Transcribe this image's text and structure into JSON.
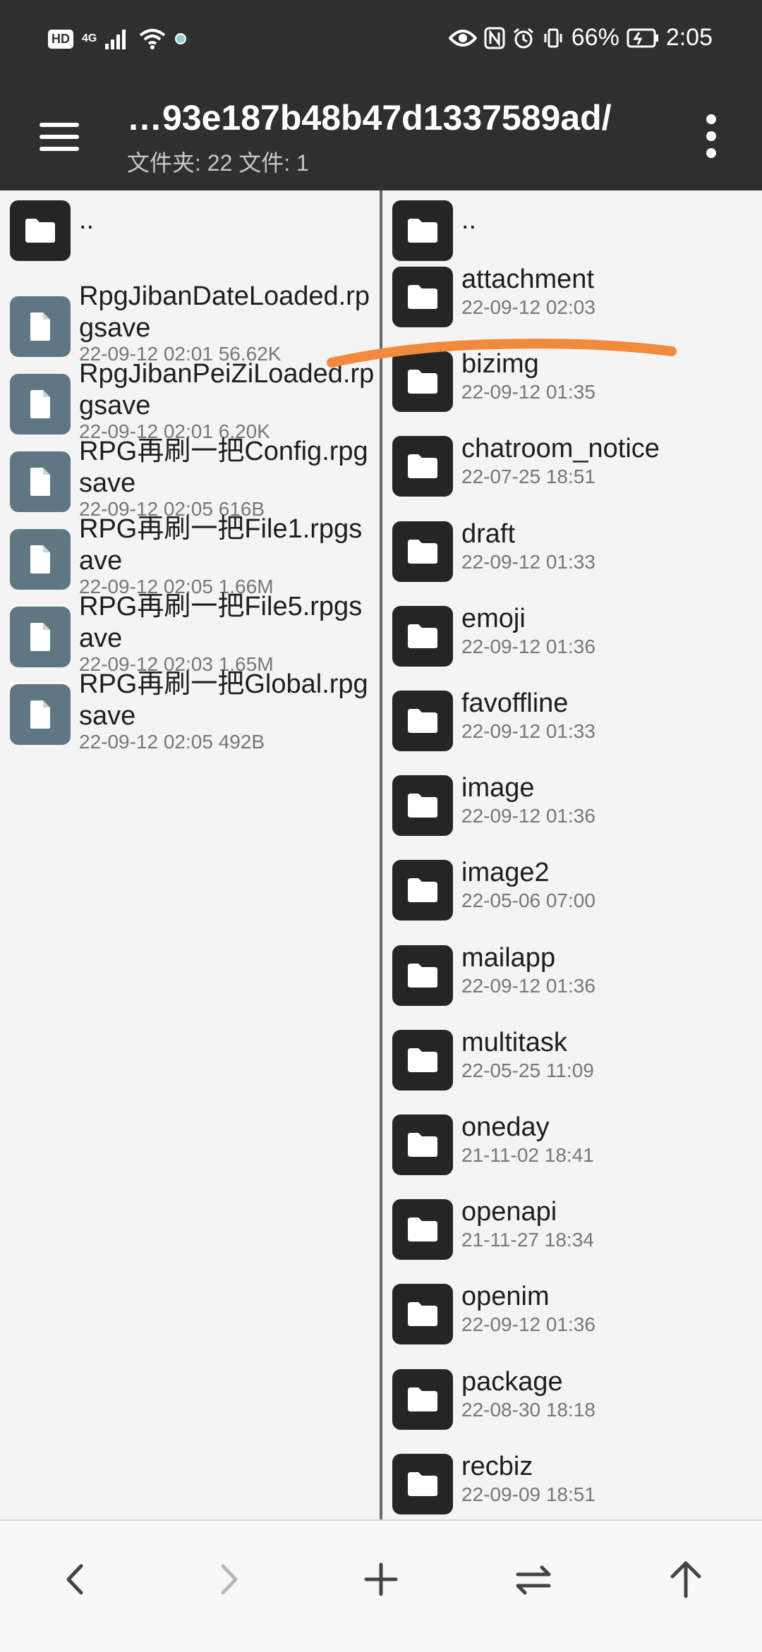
{
  "status_bar": {
    "hd_label": "HD",
    "network_label": "4G",
    "battery_percent": "66%",
    "time": "2:05"
  },
  "app_bar": {
    "path": "…93e187b48b47d1337589ad/",
    "counts": "文件夹: 22  文件: 1"
  },
  "left_pane": {
    "items": [
      {
        "type": "folder",
        "name": "..",
        "meta": ""
      },
      {
        "type": "file",
        "name": "RpgJibanDateLoaded.rpgsave",
        "meta": "22-09-12 02:01  56.62K"
      },
      {
        "type": "file",
        "name": "RpgJibanPeiZiLoaded.rpgsave",
        "meta": "22-09-12 02:01  6.20K"
      },
      {
        "type": "file",
        "name": "RPG再刷一把Config.rpgsave",
        "meta": "22-09-12 02:05  616B"
      },
      {
        "type": "file",
        "name": "RPG再刷一把File1.rpgsave",
        "meta": "22-09-12 02:05  1.66M"
      },
      {
        "type": "file",
        "name": "RPG再刷一把File5.rpgsave",
        "meta": "22-09-12 02:03  1.65M"
      },
      {
        "type": "file",
        "name": "RPG再刷一把Global.rpgsave",
        "meta": "22-09-12 02:05  492B"
      }
    ]
  },
  "right_pane": {
    "items": [
      {
        "type": "folder",
        "name": "..",
        "meta": ""
      },
      {
        "type": "folder",
        "name": "attachment",
        "meta": "22-09-12 02:03"
      },
      {
        "type": "folder",
        "name": "bizimg",
        "meta": "22-09-12 01:35"
      },
      {
        "type": "folder",
        "name": "chatroom_notice",
        "meta": "22-07-25 18:51"
      },
      {
        "type": "folder",
        "name": "draft",
        "meta": "22-09-12 01:33"
      },
      {
        "type": "folder",
        "name": "emoji",
        "meta": "22-09-12 01:36"
      },
      {
        "type": "folder",
        "name": "favoffline",
        "meta": "22-09-12 01:33"
      },
      {
        "type": "folder",
        "name": "image",
        "meta": "22-09-12 01:36"
      },
      {
        "type": "folder",
        "name": "image2",
        "meta": "22-05-06 07:00"
      },
      {
        "type": "folder",
        "name": "mailapp",
        "meta": "22-09-12 01:36"
      },
      {
        "type": "folder",
        "name": "multitask",
        "meta": "22-05-25 11:09"
      },
      {
        "type": "folder",
        "name": "oneday",
        "meta": "21-11-02 18:41"
      },
      {
        "type": "folder",
        "name": "openapi",
        "meta": "21-11-27 18:34"
      },
      {
        "type": "folder",
        "name": "openim",
        "meta": "22-09-12 01:36"
      },
      {
        "type": "folder",
        "name": "package",
        "meta": "22-08-30 18:18"
      },
      {
        "type": "folder",
        "name": "recbiz",
        "meta": "22-09-09 18:51"
      }
    ]
  },
  "bottom_bar": {
    "buttons": [
      "back-icon",
      "forward-icon",
      "plus-icon",
      "swap-icon",
      "up-arrow-icon"
    ]
  },
  "colors": {
    "bar_background": "#2f2f2f",
    "folder_icon": "#252525",
    "file_icon": "#5f7683",
    "annotation_stroke": "#f08a3c"
  }
}
